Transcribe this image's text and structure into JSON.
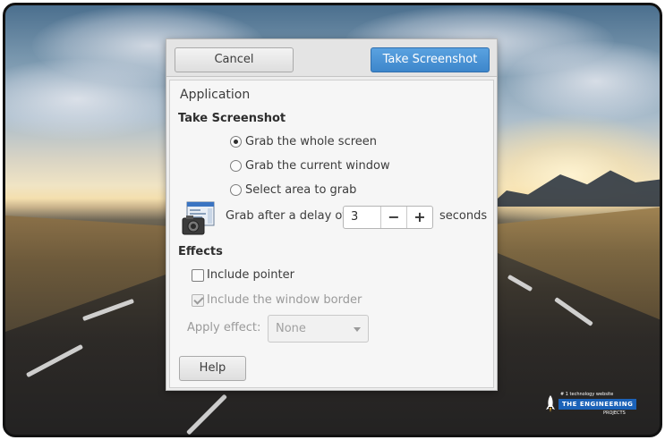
{
  "dialog": {
    "cancel_label": "Cancel",
    "take_label": "Take Screenshot",
    "application_label": "Application",
    "take_section_title": "Take Screenshot",
    "options": [
      {
        "label": "Grab the whole screen",
        "selected": true
      },
      {
        "label": "Grab the current window",
        "selected": false
      },
      {
        "label": "Select area to grab",
        "selected": false
      }
    ],
    "delay_label": "Grab after a delay of",
    "delay_value": "3",
    "delay_minus": "−",
    "delay_plus": "+",
    "delay_unit": "seconds",
    "effects_title": "Effects",
    "include_pointer": {
      "label": "Include pointer",
      "checked": false
    },
    "include_border": {
      "label": "Include the window border",
      "checked": true,
      "disabled": true
    },
    "apply_effect_label": "Apply effect:",
    "apply_effect_value": "None",
    "help_label": "Help"
  },
  "watermark": {
    "brand": "THE ENGINEERING",
    "tagline": "# 1 technology website",
    "sub": "PROJECTS"
  },
  "colors": {
    "primary_button": "#3d86cb",
    "dialog_bg": "#ededed",
    "logo_blue": "#1b62b8"
  }
}
